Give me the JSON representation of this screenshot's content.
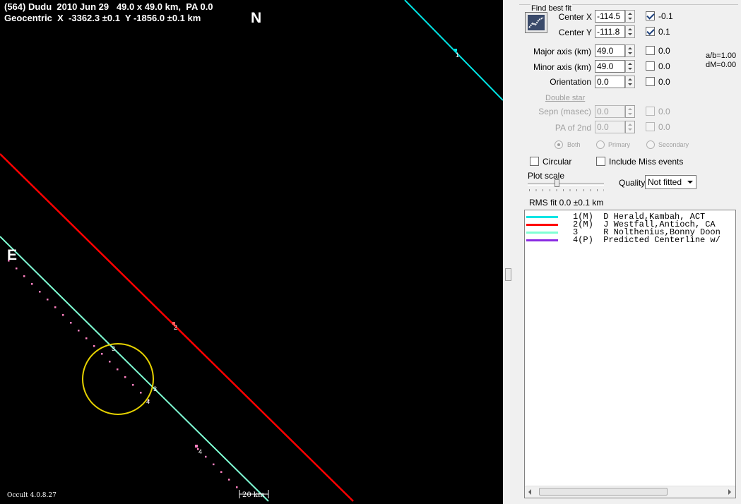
{
  "plot": {
    "title_line1": "(564) Dudu  2010 Jun 29   49.0 x 49.0 km,  PA 0.0",
    "title_line2": "Geocentric  X  -3362.3 ±0.1  Y -1856.0 ±0.1 km",
    "north_label": "N",
    "east_label": "E",
    "version": "Occult 4.0.8.27",
    "scale_label": "20 km",
    "chord_labels": [
      "1",
      "2",
      "3",
      "3",
      "4",
      "4"
    ],
    "colors": {
      "background": "#000000",
      "chord1": "#00e5e5",
      "chord2": "#ff0000",
      "chord3": "#7fffd4",
      "centerline": "#ff80c0",
      "ellipse": "#e6d200"
    }
  },
  "panel": {
    "group_title": "Find best fit",
    "fit_button_icon": "fit-chart-icon",
    "center_x_label": "Center X",
    "center_x_value": "-114.5",
    "center_x_check_label": "-0.1",
    "center_y_label": "Center Y",
    "center_y_value": "-111.8",
    "center_y_check_label": "0.1",
    "major_label": "Major axis (km)",
    "major_value": "49.0",
    "major_check_label": "0.0",
    "minor_label": "Minor axis (km)",
    "minor_value": "49.0",
    "minor_check_label": "0.0",
    "orient_label": "Orientation",
    "orient_value": "0.0",
    "orient_check_label": "0.0",
    "ab_ratio": "a/b=1.00",
    "dm": "dM=0.00",
    "double_star_link": "Double star",
    "sepn_label": "Sepn (masec)",
    "sepn_value": "0.0",
    "sepn_check_label": "0.0",
    "pa2_label": "PA of 2nd",
    "pa2_value": "0.0",
    "pa2_check_label": "0.0",
    "radio_both": "Both",
    "radio_primary": "Primary",
    "radio_secondary": "Secondary",
    "circular_label": "Circular",
    "include_miss_label": "Include Miss events",
    "plot_scale_label": "Plot scale",
    "quality_label": "Quality",
    "quality_value": "Not fitted",
    "rms_text": "RMS fit  0.0 ±0.1 km"
  },
  "observers": [
    {
      "text": "1(M)  D Herald,Kambah, ACT",
      "color": "#00e5e5"
    },
    {
      "text": "2(M)  J Westfall,Antioch, CA",
      "color": "#ff0000"
    },
    {
      "text": "3     R Nolthenius,Bonny Doon",
      "color": "#7fffd4"
    },
    {
      "text": "4(P)  Predicted Centerline w/",
      "color": "#8a2be2"
    }
  ]
}
